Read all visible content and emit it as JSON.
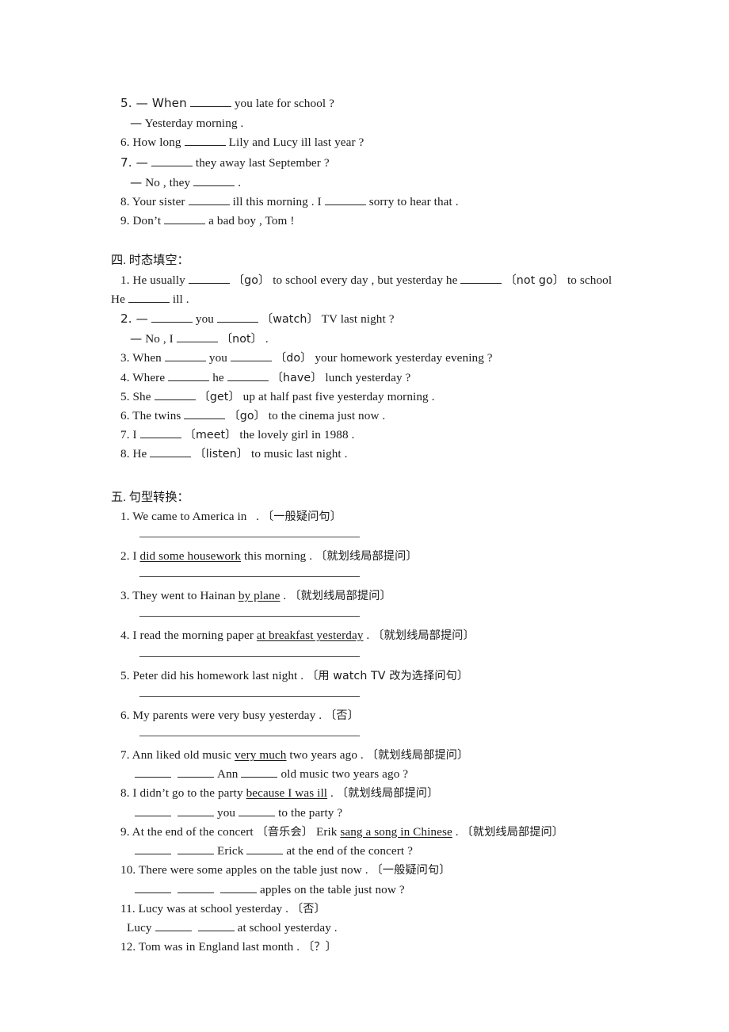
{
  "document": {
    "type": "english-grammar-worksheet",
    "language_note": "Chinese instructions with English exercises"
  },
  "top_block": {
    "items": [
      {
        "id": "q5",
        "indent": "num",
        "text": "5. — When ___ you late for school ?"
      },
      {
        "id": "q5b",
        "indent": "dash",
        "text": "— Yesterday morning ."
      },
      {
        "id": "q6",
        "indent": "num",
        "text": "6. How long ___ Lily and Lucy ill last year ?"
      },
      {
        "id": "q7",
        "indent": "num",
        "text": "7. — ___ they away last September ?"
      },
      {
        "id": "q7b",
        "indent": "dash",
        "text": "— No , they ___ ."
      },
      {
        "id": "q8",
        "indent": "num",
        "text": "8. Your sister ___ ill this morning . I ___ sorry to hear that ."
      },
      {
        "id": "q9",
        "indent": "num",
        "text": "9. Don’t ___ a bad boy , Tom !"
      }
    ]
  },
  "section_four": {
    "heading": "四. 时态填空：",
    "items": [
      {
        "id": "s4q1",
        "indent": "num",
        "text": "1. He usually ___ 〔go〕 to school every day , but yesterday he ___ 〔not go〕 to school"
      },
      {
        "id": "s4q1b",
        "indent": "flush",
        "text": "He ___ ill ."
      },
      {
        "id": "s4q2",
        "indent": "num",
        "text": "2. — ___ you ___ 〔watch〕 TV last night ?"
      },
      {
        "id": "s4q2b",
        "indent": "dash",
        "text": "— No , I ___ 〔not〕 ."
      },
      {
        "id": "s4q3",
        "indent": "num",
        "text": "3. When ___ you ___ 〔do〕 your homework yesterday evening ?"
      },
      {
        "id": "s4q4",
        "indent": "num",
        "text": "4. Where ___ he ___ 〔have〕 lunch yesterday ?"
      },
      {
        "id": "s4q5",
        "indent": "num",
        "text": "5. She ___ 〔get〕 up at half past five yesterday morning ."
      },
      {
        "id": "s4q6",
        "indent": "num",
        "text": "6. The twins ___ 〔go〕 to the cinema just now ."
      },
      {
        "id": "s4q7",
        "indent": "num",
        "text": "7. I ___ 〔meet〕 the lovely girl in 1988 ."
      },
      {
        "id": "s4q8",
        "indent": "num",
        "text": "8. He ___ 〔listen〕 to music last night ."
      }
    ]
  },
  "section_five": {
    "heading": "五. 句型转换：",
    "annotations": {
      "general_question": "〔一般疑问句〕",
      "ask_underlined": "〔就划线局部提问〕",
      "alternative_question": "〔用 watch TV 改为选择问句〕",
      "negative": "〔否〕",
      "question_mark": "〔？〕",
      "concert_gloss": "〔音乐会〕"
    },
    "items": [
      {
        "id": "s5q1",
        "number": "1.",
        "prefix": "We came to America in   .",
        "note": "〔一般疑问句〕",
        "rule": true
      },
      {
        "id": "s5q2",
        "number": "2.",
        "before": "I ",
        "underline": "did some housework",
        "after": " this morning .",
        "note": "〔就划线局部提问〕",
        "rule": true
      },
      {
        "id": "s5q3",
        "number": "3.",
        "before": "They went to Hainan ",
        "underline": "by plane",
        "after": " .",
        "note": "〔就划线局部提问〕",
        "rule": true
      },
      {
        "id": "s5q4",
        "number": "4.",
        "before": "I read the morning paper ",
        "underline": "at breakfast yesterday",
        "after": " .",
        "note": "〔就划线局部提问〕",
        "rule": true
      },
      {
        "id": "s5q5",
        "number": "5.",
        "prefix": "Peter did his homework last night .",
        "note": "〔用 watch TV 改为选择问句〕",
        "rule": true
      },
      {
        "id": "s5q6",
        "number": "6.",
        "prefix": "My parents were very busy yesterday .",
        "note": "〔否〕",
        "rule": true
      },
      {
        "id": "s5q7",
        "number": "7.",
        "before": "Ann liked old music ",
        "underline": "very much",
        "after": " two years ago .",
        "note": "〔就划线局部提问〕",
        "answer_line": "___ ___ Ann ___ old music two years ago ?"
      },
      {
        "id": "s5q8",
        "number": "8.",
        "before": "I didn’t go to the party ",
        "underline": "because I was ill",
        "after": " .",
        "note": "〔就划线局部提问〕",
        "answer_line": "___ ___ you ___ to the party ?"
      },
      {
        "id": "s5q9",
        "number": "9.",
        "before": "At the end of the concert 〔音乐会〕 Erik ",
        "underline": "sang a song in Chinese",
        "after": " .",
        "note": "〔就划线局部提问〕",
        "answer_line": "___ ___ Erick ___ at the end of the concert ?"
      },
      {
        "id": "s5q10",
        "number": "10.",
        "prefix": "There were some apples on the table just now .",
        "note": "〔一般疑问句〕",
        "answer_line": "___ ___ ___ apples on the table just now ?"
      },
      {
        "id": "s5q11",
        "number": "11.",
        "prefix": "Lucy was at school yesterday .",
        "note": "〔否〕",
        "answer_line": "Lucy ___ ___ at school yesterday ."
      },
      {
        "id": "s5q12",
        "number": "12.",
        "prefix": "Tom was in England last month .",
        "note": "〔？〕"
      }
    ]
  }
}
